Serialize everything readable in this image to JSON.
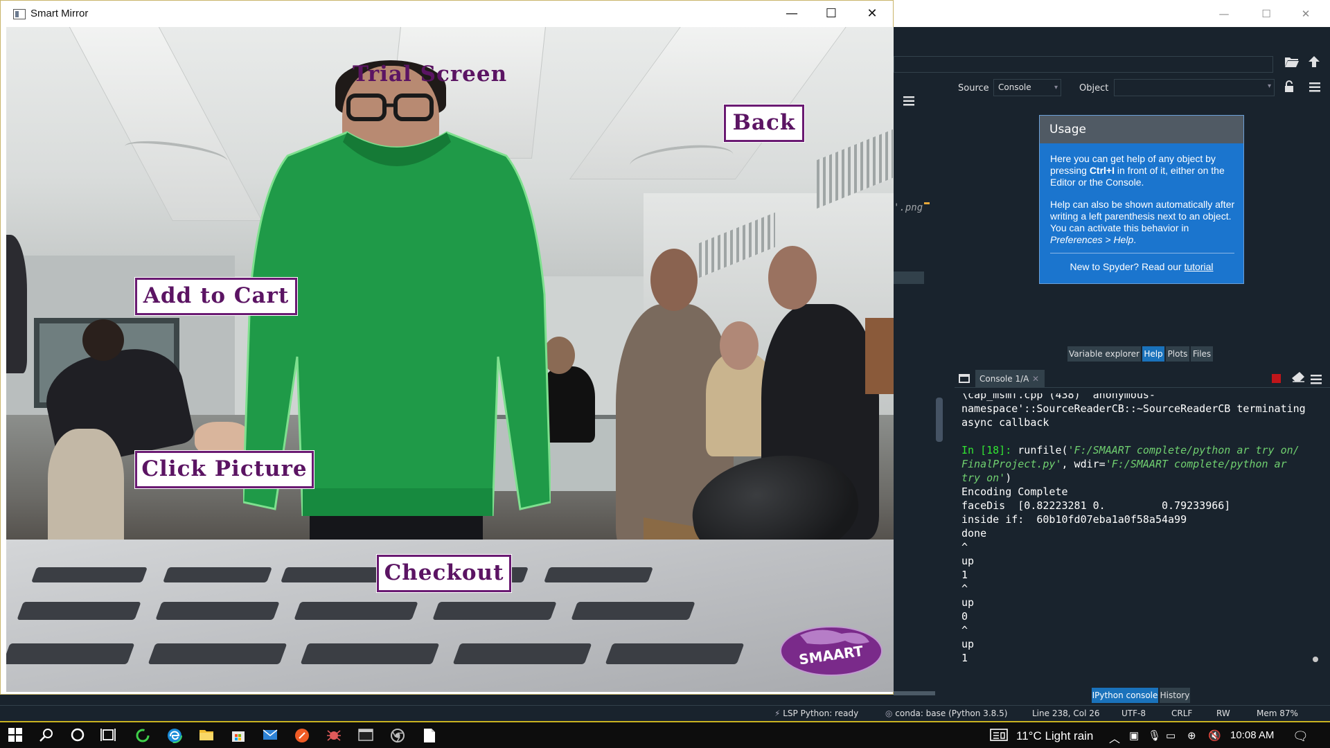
{
  "mirror": {
    "title": "Smart Mirror",
    "controls": {
      "minimize": "—",
      "maximize": "☐",
      "close": "✕"
    },
    "overlay": {
      "heading": "Trial Screen",
      "back": "Back",
      "add_to_cart": "Add to Cart",
      "click_picture": "Click Picture",
      "checkout": "Checkout",
      "logo": "SMAART"
    }
  },
  "spyder": {
    "window_controls": {
      "minimize": "—",
      "maximize": "☐",
      "close": "✕"
    },
    "editor": {
      "visible_text": "'.png"
    },
    "help": {
      "source_label": "Source",
      "source_value": "Console",
      "object_label": "Object",
      "usage": {
        "title": "Usage",
        "p1_before": "Here you can get help of any object by pressing ",
        "p1_bold": "Ctrl+I",
        "p1_after": " in front of it, either on the Editor or the Console.",
        "p2_before": "Help can also be shown automatically after writing a left parenthesis next to an object. You can activate this behavior in ",
        "p2_italic": "Preferences > Help",
        "p2_after": ".",
        "new_text": "New to Spyder? Read our ",
        "tutorial_link": "tutorial"
      },
      "tabs": [
        {
          "label": "Variable explorer",
          "active": false
        },
        {
          "label": "Help",
          "active": true
        },
        {
          "label": "Plots",
          "active": false
        },
        {
          "label": "Files",
          "active": false
        }
      ]
    },
    "console": {
      "tab_label": "Console 1/A",
      "tab_close": "✕",
      "lines": {
        "l1": "\\cap_msmf.cpp (438)  anonymous-",
        "l2": "namespace'::SourceReaderCB::~SourceReaderCB terminating",
        "l3": "async callback",
        "prompt": "In [18]:",
        "run_a": " runfile(",
        "run_str1": "'F:/SMAART complete/python ar try on/",
        "run_str1b": "FinalProject.py'",
        "run_b": ", wdir=",
        "run_str2": "'F:/SMAART complete/python ar",
        "run_str2b": "try on'",
        "run_c": ")",
        "l5": "Encoding Complete",
        "l6": "faceDis  [0.82223281 0.         0.79233966]",
        "l7": "inside if:  60b10fd07eba1a0f58a54a99",
        "l8": "done",
        "l9": "^",
        "l10": "up",
        "l11": "1",
        "l12": "^",
        "l13": "up",
        "l14": "0",
        "l15": "^",
        "l16": "up",
        "l17": "1"
      },
      "bottom_tabs": [
        {
          "label": "IPython console",
          "active": true
        },
        {
          "label": "History",
          "active": false
        }
      ]
    },
    "statusbar": {
      "lsp": "LSP Python: ready",
      "conda": "conda: base (Python 3.8.5)",
      "position": "Line 238, Col 26",
      "encoding": "UTF-8",
      "eol": "CRLF",
      "permissions": "RW",
      "memory": "Mem 87%"
    }
  },
  "taskbar": {
    "weather": "11°C  Light rain",
    "time": "10:08 AM"
  },
  "colors": {
    "overlay_text": "#5b1463",
    "sweater": "#1f9a48",
    "spyder_bg": "#19232d",
    "help_blue": "#1b75ce"
  }
}
